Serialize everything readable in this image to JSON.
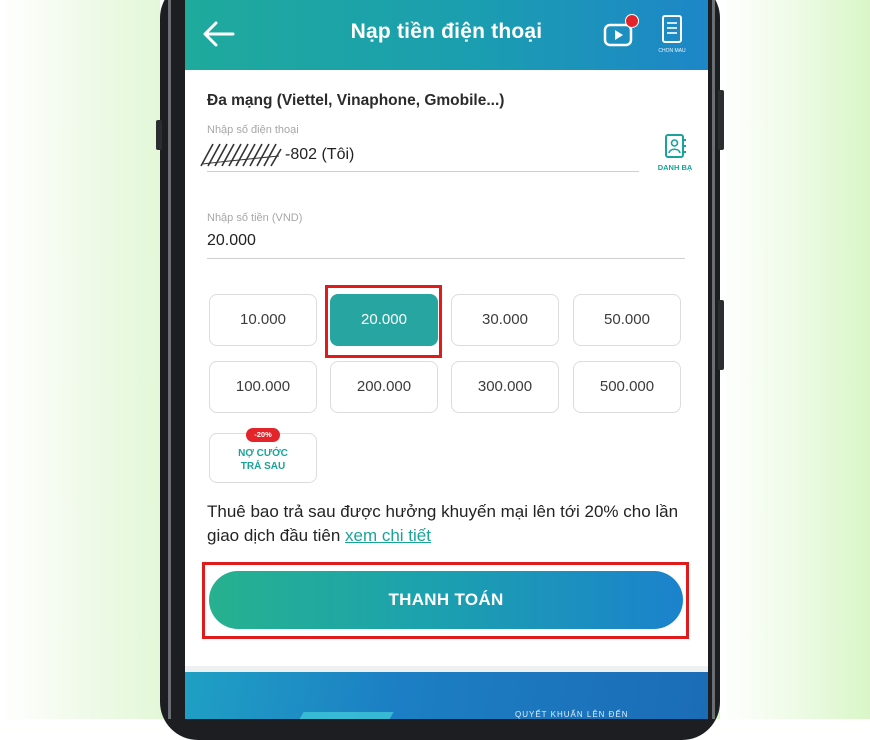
{
  "header": {
    "title": "Nạp tiền điện thoại",
    "receipt_label": "CHON MAU"
  },
  "form": {
    "network_label": "Đa mạng (Viettel, Vinaphone, Gmobile...)",
    "phone_placeholder": "Nhập số điện thoại",
    "phone_value": "-802 (Tôi)",
    "contacts_label": "DANH BẠ",
    "amount_placeholder": "Nhập số tiền (VND)",
    "amount_value": "20.000"
  },
  "amounts": [
    "10.000",
    "20.000",
    "30.000",
    "50.000",
    "100.000",
    "200.000",
    "300.000",
    "500.000"
  ],
  "selected_amount": "20.000",
  "postpaid": {
    "badge": "-20%",
    "line1": "NỢ CƯỚC",
    "line2": "TRẢ SAU"
  },
  "promo": {
    "text": "Thuê bao trả sau được hưởng khuyến mại lên tới 20% cho lần giao dịch đầu tiên",
    "link": "xem chi tiết"
  },
  "pay_button": "THANH TOÁN",
  "banner_text": "QUYẾT KHUẤN LÊN ĐẾN",
  "colors": {
    "accent": "#27a5a1",
    "highlight": "#e01b1b",
    "header_start": "#1eaa9c",
    "header_end": "#1d86c8"
  }
}
